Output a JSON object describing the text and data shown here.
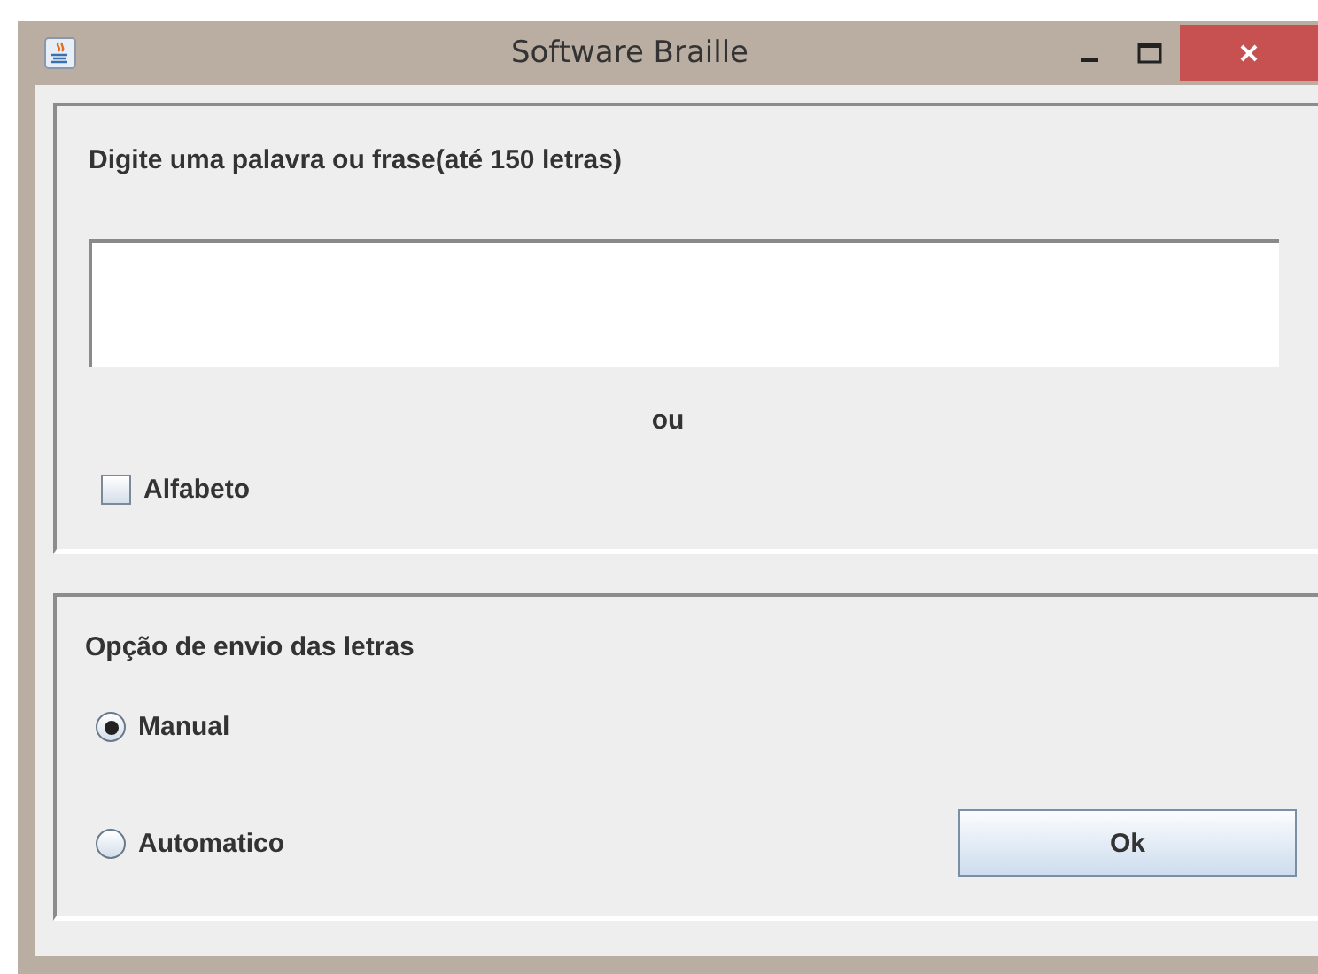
{
  "window": {
    "title": "Software Braille"
  },
  "input_panel": {
    "label": "Digite uma palavra ou frase(até 150 letras)",
    "separator": "ou",
    "alphabet_checkbox": {
      "label": "Alfabeto",
      "checked": false
    }
  },
  "send_panel": {
    "label": "Opção de envio das letras",
    "options": [
      {
        "label": "Manual",
        "selected": true
      },
      {
        "label": "Automatico",
        "selected": false
      }
    ],
    "ok_button": "Ok"
  }
}
